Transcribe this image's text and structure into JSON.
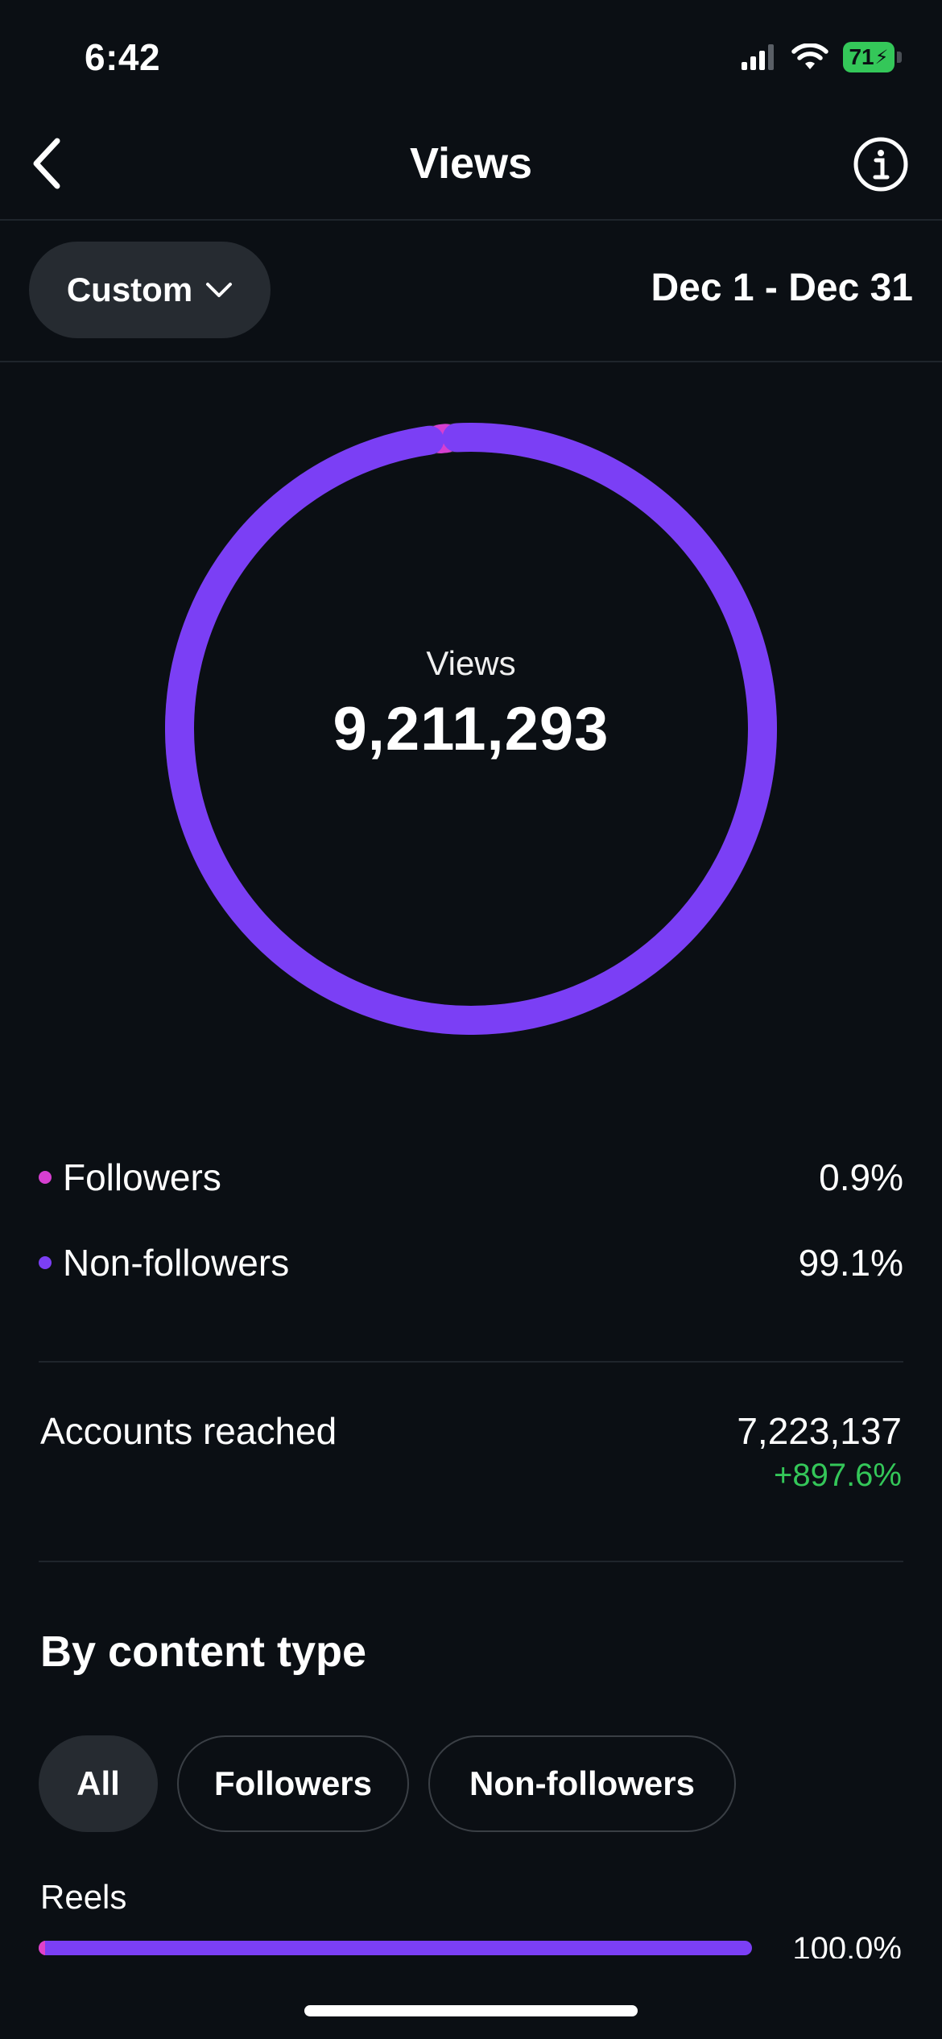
{
  "status_bar": {
    "time": "6:42",
    "battery": "71"
  },
  "header": {
    "title": "Views"
  },
  "filter": {
    "period_label": "Custom",
    "date_range": "Dec 1 - Dec 31"
  },
  "donut": {
    "label": "Views",
    "value": "9,211,293",
    "segments": [
      {
        "name": "Followers",
        "fraction": 0.009,
        "color": "#d63fd0"
      },
      {
        "name": "Non-followers",
        "fraction": 0.991,
        "color": "#7b3ff5"
      }
    ]
  },
  "legend": [
    {
      "label": "Followers",
      "value": "0.9%",
      "color": "#d63fd0"
    },
    {
      "label": "Non-followers",
      "value": "99.1%",
      "color": "#7b3ff5"
    }
  ],
  "accounts_reached": {
    "label": "Accounts reached",
    "value": "7,223,137",
    "change": "+897.6%"
  },
  "content_type": {
    "title": "By content type",
    "tabs": [
      {
        "label": "All"
      },
      {
        "label": "Followers"
      },
      {
        "label": "Non-followers"
      }
    ],
    "rows": [
      {
        "label": "Reels",
        "value": "100.0%",
        "followers_fraction": 0.009
      }
    ]
  }
}
